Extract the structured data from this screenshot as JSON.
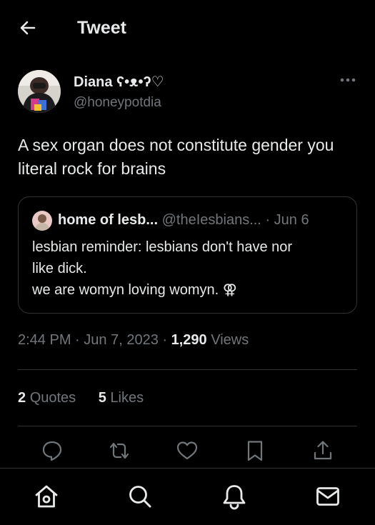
{
  "header": {
    "title": "Tweet"
  },
  "author": {
    "name": "Diana ʕ•ᴥ•ʔ♡",
    "handle": "@honeypotdia"
  },
  "tweet": {
    "text": "A sex organ does not constitute gender you literal rock for brains"
  },
  "quote": {
    "name": "home of lesb...",
    "handle": "@theIesbians...",
    "separator": "·",
    "date": "Jun 6",
    "lines": [
      "lesbian reminder: lesbians don't have nor",
      "like dick.",
      "we are womyn loving womyn. ⚢"
    ]
  },
  "meta": {
    "time": "2:44 PM",
    "sep1": "·",
    "date": "Jun 7, 2023",
    "sep2": "·",
    "views_count": "1,290",
    "views_label": "Views"
  },
  "stats": {
    "quotes_count": "2",
    "quotes_label": "Quotes",
    "likes_count": "5",
    "likes_label": "Likes"
  },
  "actions": [
    "reply-icon",
    "retweet-icon",
    "like-icon",
    "bookmark-icon",
    "share-icon"
  ],
  "nav": [
    "home-icon",
    "search-icon",
    "notifications-icon",
    "messages-icon"
  ],
  "colors": {
    "background": "#000000",
    "text": "#e7e9ea",
    "secondary": "#71767b",
    "border": "#2f3336"
  }
}
